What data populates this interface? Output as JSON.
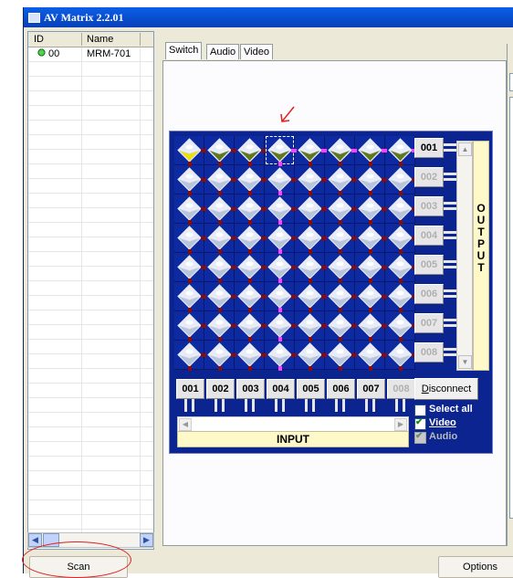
{
  "window": {
    "title": "AV Matrix 2.2.01"
  },
  "device_list": {
    "columns": [
      "ID",
      "Name"
    ],
    "rows": [
      {
        "id": "00",
        "name": "MRM-701"
      }
    ]
  },
  "tabs": [
    "Switch",
    "Audio",
    "Video"
  ],
  "matrix": {
    "outputs": [
      "001",
      "002",
      "003",
      "004",
      "005",
      "006",
      "007",
      "008"
    ],
    "inputs": [
      "001",
      "002",
      "003",
      "004",
      "005",
      "006",
      "007",
      "008"
    ],
    "output_label": "OUTPUT",
    "input_label": "INPUT",
    "disconnect_label": "Disconnect",
    "select_all_label": "Select all",
    "video_label": "Video",
    "audio_label": "Audio",
    "video_checked": true,
    "audio_checked": true,
    "audio_enabled": false
  },
  "buttons": {
    "scan": "Scan",
    "options": "Options"
  },
  "colors": {
    "matrix_bg": "#0c2490",
    "label_bg": "#fff8c8",
    "connection": "#ff40ff",
    "annotation": "#e02020"
  }
}
